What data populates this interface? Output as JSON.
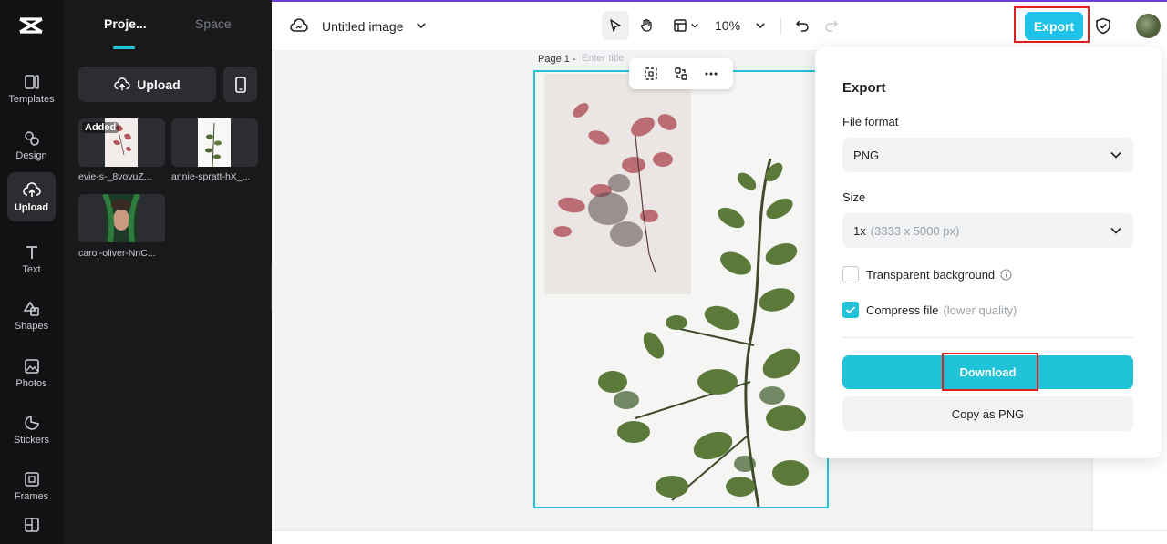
{
  "sidebar": {
    "logo_icon": "capcut-logo-icon",
    "items": [
      {
        "label": "Templates",
        "icon": "templates-icon"
      },
      {
        "label": "Design",
        "icon": "design-icon"
      },
      {
        "label": "Upload",
        "icon": "upload-cloud-icon",
        "active": true
      },
      {
        "label": "Text",
        "icon": "text-icon"
      },
      {
        "label": "Shapes",
        "icon": "shapes-icon"
      },
      {
        "label": "Photos",
        "icon": "photos-icon"
      },
      {
        "label": "Stickers",
        "icon": "stickers-icon"
      },
      {
        "label": "Frames",
        "icon": "frames-icon"
      }
    ]
  },
  "panel": {
    "tabs": [
      "Proje...",
      "Space"
    ],
    "upload_label": "Upload",
    "assets": [
      {
        "name": "evie-s-_8vovuZ...",
        "badge": "Added"
      },
      {
        "name": "annie-spratt-hX_..."
      },
      {
        "name": "carol-oliver-NnC..."
      }
    ]
  },
  "toolbar": {
    "title": "Untitled image",
    "zoom": "10%",
    "export_label": "Export"
  },
  "canvas": {
    "page_label": "Page 1 -",
    "title_placeholder": "Enter title"
  },
  "export_panel": {
    "title": "Export",
    "file_format_label": "File format",
    "file_format_value": "PNG",
    "size_label": "Size",
    "size_value": "1x",
    "size_detail": "(3333 x 5000 px)",
    "transparent_label": "Transparent background",
    "transparent_checked": false,
    "compress_label": "Compress file",
    "compress_detail": "(lower quality)",
    "compress_checked": true,
    "download_label": "Download",
    "copy_label": "Copy as PNG"
  },
  "colors": {
    "accent": "#20c3d8",
    "export_button": "#20c3e8",
    "highlight_box": "#e0201f",
    "sidebar_bg": "#111214",
    "panel_bg": "#18191b"
  }
}
